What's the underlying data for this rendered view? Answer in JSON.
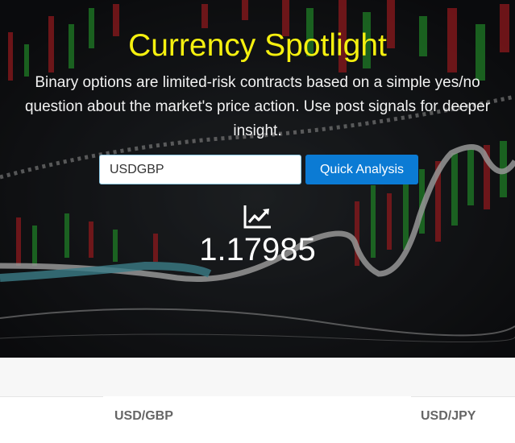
{
  "hero": {
    "title": "Currency Spotlight",
    "description": "Binary options are limited-risk contracts based on a simple yes/no question about the market's price action. Use post signals for deeper insight.",
    "title_color": "#f5f00f"
  },
  "search": {
    "value": "USDGBP",
    "button_label": "Quick Analysis",
    "button_color": "#0b7bd4"
  },
  "quote": {
    "icon": "trending-up-icon",
    "rate": "1.17985"
  },
  "pairs": [
    "USD/GBP",
    "USD/JPY"
  ]
}
